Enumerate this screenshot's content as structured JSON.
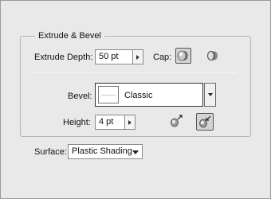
{
  "group": {
    "title": "Extrude & Bevel"
  },
  "extrude_depth": {
    "label": "Extrude Depth:",
    "value": "50 pt"
  },
  "cap": {
    "label": "Cap:",
    "on_icon": "cap-on-icon",
    "off_icon": "cap-off-icon",
    "selected": "on"
  },
  "bevel": {
    "label": "Bevel:",
    "value": "Classic"
  },
  "height": {
    "label": "Height:",
    "value": "4 pt",
    "out_icon": "bevel-extent-out-icon",
    "in_icon": "bevel-extent-in-icon",
    "selected": "in"
  },
  "surface": {
    "label": "Surface:",
    "value": "Plastic Shading"
  }
}
